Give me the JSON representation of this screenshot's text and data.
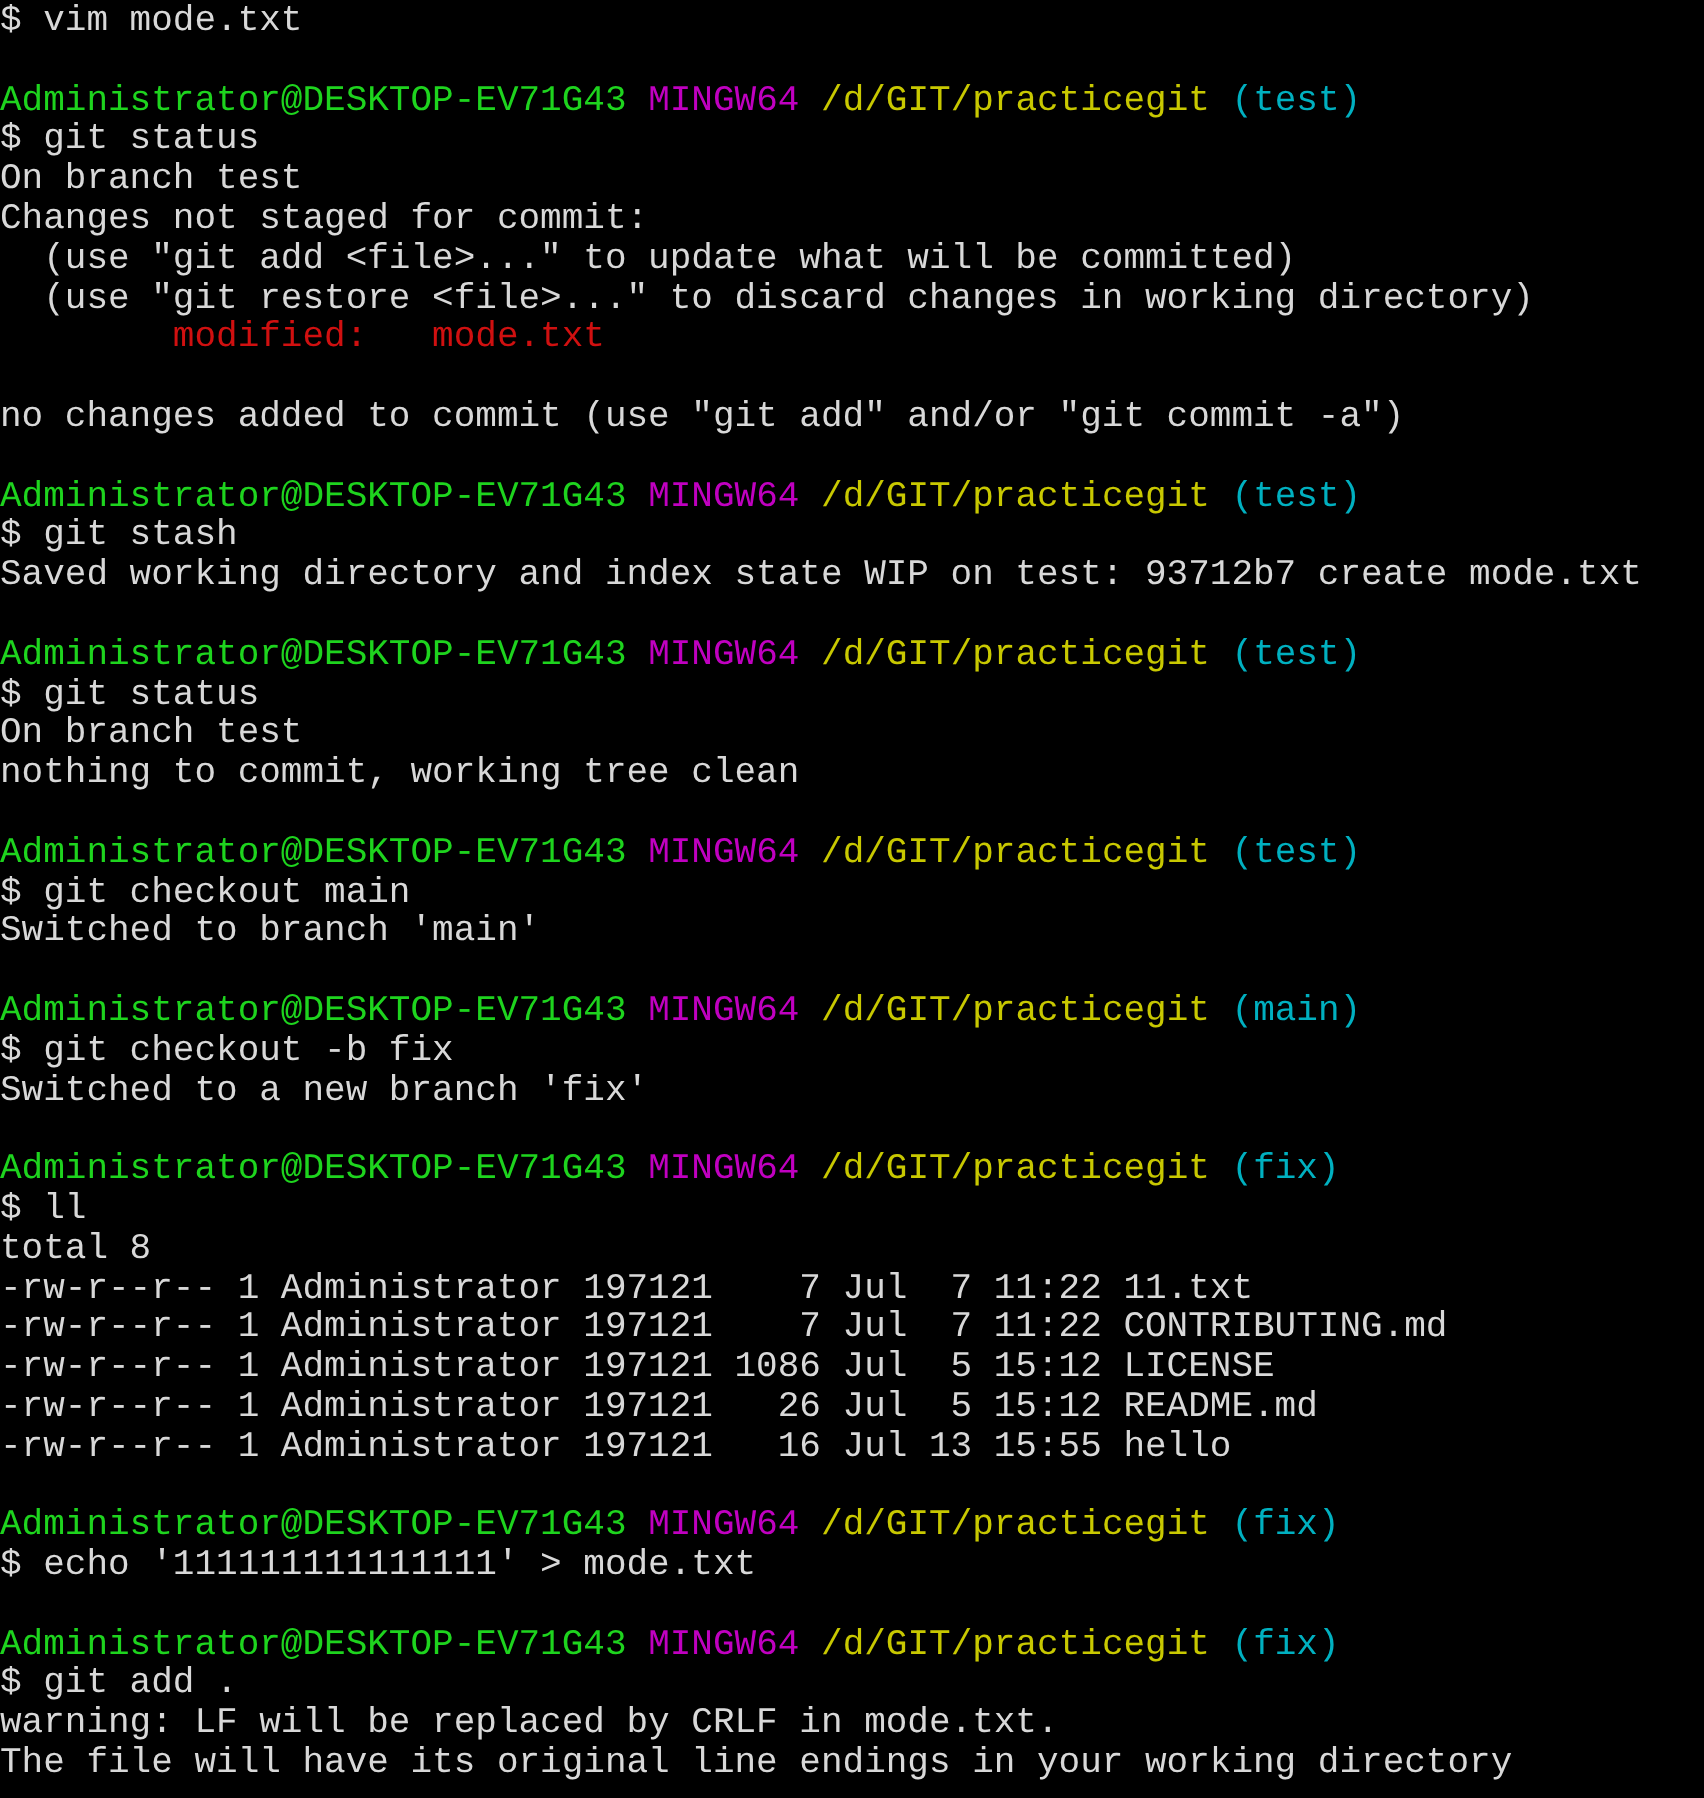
{
  "terminal": {
    "lines": [
      {
        "kind": "command",
        "text": "$ vim mode.txt"
      },
      {
        "kind": "blank"
      },
      {
        "kind": "prompt",
        "user": "Administrator@DESKTOP-EV71G43",
        "system": "MINGW64",
        "path": "/d/GIT/practicegit",
        "branch": "(test)"
      },
      {
        "kind": "command",
        "text": "$ git status"
      },
      {
        "kind": "output",
        "text": "On branch test"
      },
      {
        "kind": "output",
        "text": "Changes not staged for commit:"
      },
      {
        "kind": "output",
        "text": "  (use \"git add <file>...\" to update what will be committed)"
      },
      {
        "kind": "output",
        "text": "  (use \"git restore <file>...\" to discard changes in working directory)"
      },
      {
        "kind": "change",
        "label": "modified:",
        "file": "mode.txt"
      },
      {
        "kind": "blank"
      },
      {
        "kind": "output",
        "text": "no changes added to commit (use \"git add\" and/or \"git commit -a\")"
      },
      {
        "kind": "blank"
      },
      {
        "kind": "prompt",
        "user": "Administrator@DESKTOP-EV71G43",
        "system": "MINGW64",
        "path": "/d/GIT/practicegit",
        "branch": "(test)"
      },
      {
        "kind": "command",
        "text": "$ git stash"
      },
      {
        "kind": "output",
        "text": "Saved working directory and index state WIP on test: 93712b7 create mode.txt"
      },
      {
        "kind": "blank"
      },
      {
        "kind": "prompt",
        "user": "Administrator@DESKTOP-EV71G43",
        "system": "MINGW64",
        "path": "/d/GIT/practicegit",
        "branch": "(test)"
      },
      {
        "kind": "command",
        "text": "$ git status"
      },
      {
        "kind": "output",
        "text": "On branch test"
      },
      {
        "kind": "output",
        "text": "nothing to commit, working tree clean"
      },
      {
        "kind": "blank"
      },
      {
        "kind": "prompt",
        "user": "Administrator@DESKTOP-EV71G43",
        "system": "MINGW64",
        "path": "/d/GIT/practicegit",
        "branch": "(test)"
      },
      {
        "kind": "command",
        "text": "$ git checkout main"
      },
      {
        "kind": "output",
        "text": "Switched to branch 'main'"
      },
      {
        "kind": "blank"
      },
      {
        "kind": "prompt",
        "user": "Administrator@DESKTOP-EV71G43",
        "system": "MINGW64",
        "path": "/d/GIT/practicegit",
        "branch": "(main)"
      },
      {
        "kind": "command",
        "text": "$ git checkout -b fix"
      },
      {
        "kind": "output",
        "text": "Switched to a new branch 'fix'"
      },
      {
        "kind": "blank"
      },
      {
        "kind": "prompt",
        "user": "Administrator@DESKTOP-EV71G43",
        "system": "MINGW64",
        "path": "/d/GIT/practicegit",
        "branch": "(fix)"
      },
      {
        "kind": "command",
        "text": "$ ll"
      },
      {
        "kind": "output",
        "text": "total 8"
      },
      {
        "kind": "output",
        "text": "-rw-r--r-- 1 Administrator 197121    7 Jul  7 11:22 11.txt"
      },
      {
        "kind": "output",
        "text": "-rw-r--r-- 1 Administrator 197121    7 Jul  7 11:22 CONTRIBUTING.md"
      },
      {
        "kind": "output",
        "text": "-rw-r--r-- 1 Administrator 197121 1086 Jul  5 15:12 LICENSE"
      },
      {
        "kind": "output",
        "text": "-rw-r--r-- 1 Administrator 197121   26 Jul  5 15:12 README.md"
      },
      {
        "kind": "output",
        "text": "-rw-r--r-- 1 Administrator 197121   16 Jul 13 15:55 hello"
      },
      {
        "kind": "blank"
      },
      {
        "kind": "prompt",
        "user": "Administrator@DESKTOP-EV71G43",
        "system": "MINGW64",
        "path": "/d/GIT/practicegit",
        "branch": "(fix)"
      },
      {
        "kind": "command",
        "text": "$ echo '111111111111111' > mode.txt"
      },
      {
        "kind": "blank"
      },
      {
        "kind": "prompt",
        "user": "Administrator@DESKTOP-EV71G43",
        "system": "MINGW64",
        "path": "/d/GIT/practicegit",
        "branch": "(fix)"
      },
      {
        "kind": "command",
        "text": "$ git add ."
      },
      {
        "kind": "output",
        "text": "warning: LF will be replaced by CRLF in mode.txt."
      },
      {
        "kind": "output",
        "text": "The file will have its original line endings in your working directory"
      }
    ]
  }
}
